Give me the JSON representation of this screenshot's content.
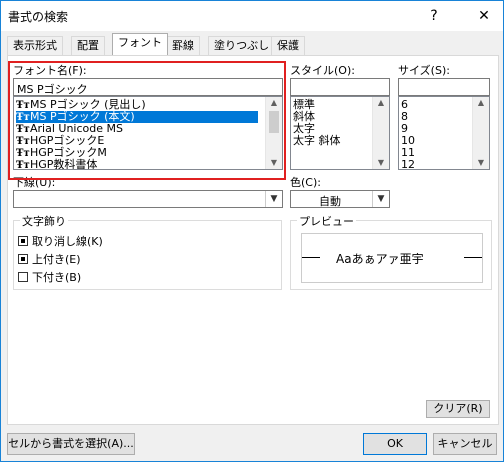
{
  "dialog": {
    "title": "書式の検索",
    "help_label": "?",
    "close_label": "✕"
  },
  "tabs": [
    {
      "label": "表示形式"
    },
    {
      "label": "配置"
    },
    {
      "label": "フォント"
    },
    {
      "label": "罫線"
    },
    {
      "label": "塗りつぶし"
    },
    {
      "label": "保護"
    }
  ],
  "font": {
    "label": "フォント名(F):",
    "value": "MS Pゴシック",
    "items": [
      {
        "label": "MS Pゴシック (見出し)"
      },
      {
        "label": "MS Pゴシック (本文)",
        "selected": true
      },
      {
        "label": "Arial Unicode MS"
      },
      {
        "label": "HGPゴシックE"
      },
      {
        "label": "HGPゴシックM"
      },
      {
        "label": "HGP教科書体"
      }
    ],
    "font_icon": "truetype-font-icon"
  },
  "style": {
    "label": "スタイル(O):",
    "value": "",
    "items": [
      {
        "label": "標準"
      },
      {
        "label": "斜体"
      },
      {
        "label": "太字"
      },
      {
        "label": "太字 斜体"
      }
    ]
  },
  "size": {
    "label": "サイズ(S):",
    "value": "",
    "items": [
      {
        "label": "6"
      },
      {
        "label": "8"
      },
      {
        "label": "9"
      },
      {
        "label": "10"
      },
      {
        "label": "11"
      },
      {
        "label": "12"
      }
    ]
  },
  "underline": {
    "label": "下線(U):",
    "value": ""
  },
  "color": {
    "label": "色(C):",
    "value": "自動"
  },
  "effects": {
    "title": "文字飾り",
    "items": [
      {
        "label": "取り消し線(K)",
        "state": "indeterminate"
      },
      {
        "label": "上付き(E)",
        "state": "indeterminate"
      },
      {
        "label": "下付き(B)",
        "state": "unchecked"
      }
    ]
  },
  "preview": {
    "title": "プレビュー",
    "sample": "Aaあぁアァ亜宇"
  },
  "buttons": {
    "clear": "クリア(R)",
    "choose_from_cell": "セルから書式を選択(A)...",
    "ok": "OK",
    "cancel": "キャンセル"
  },
  "colors": {
    "accent": "#0078d7",
    "highlight_red": "#e02020"
  }
}
